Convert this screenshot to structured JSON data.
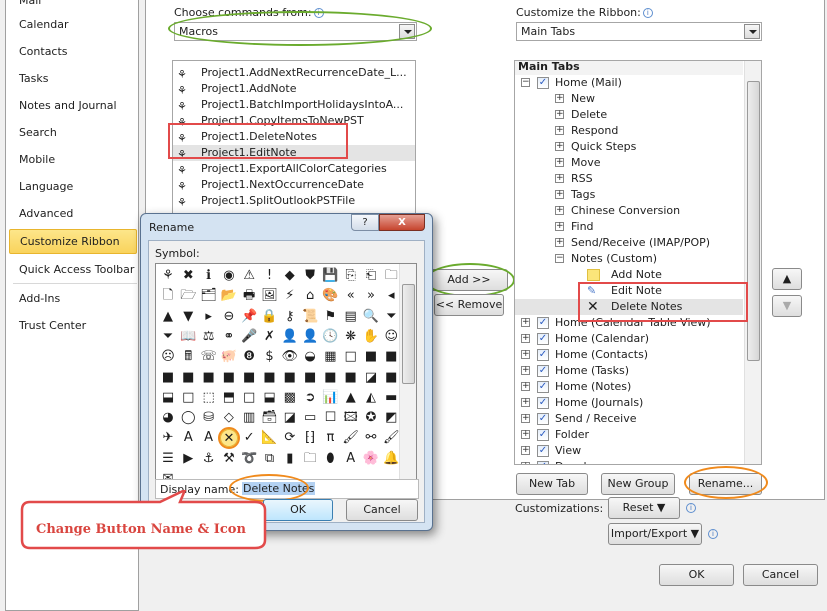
{
  "nav": {
    "items": [
      "Mail",
      "Calendar",
      "Contacts",
      "Tasks",
      "Notes and Journal",
      "Search",
      "Mobile",
      "Language",
      "Advanced",
      "Customize Ribbon",
      "Quick Access Toolbar",
      "Add-Ins",
      "Trust Center"
    ],
    "selected": "Customize Ribbon"
  },
  "commands": {
    "label": "Choose commands from:",
    "value": "Macros",
    "items": [
      "Project1.AddNextRecurrenceDate_L...",
      "Project1.AddNote",
      "Project1.BatchImportHolidaysIntoA...",
      "Project1.CopyItemsToNewPST",
      "Project1.DeleteNotes",
      "Project1.EditNote",
      "Project1.ExportAllColorCategories",
      "Project1.NextOccurrenceDate",
      "Project1.SplitOutlookPSTFile"
    ],
    "selected": "Project1.EditNote"
  },
  "middle": {
    "add": "Add >>",
    "remove": "<< Remove"
  },
  "ribbon": {
    "label": "Customize the Ribbon:",
    "value": "Main Tabs",
    "header": "Main Tabs",
    "home_mail": "Home (Mail)",
    "groups": [
      "New",
      "Delete",
      "Respond",
      "Quick Steps",
      "Move",
      "RSS",
      "Tags",
      "Chinese Conversion",
      "Find",
      "Send/Receive (IMAP/POP)"
    ],
    "custom_group": "Notes (Custom)",
    "custom_items": [
      "Add Note",
      "Edit Note",
      "Delete Notes"
    ],
    "tabs": [
      "Home (Calendar Table View)",
      "Home (Calendar)",
      "Home (Contacts)",
      "Home (Tasks)",
      "Home (Notes)",
      "Home (Journals)",
      "Send / Receive",
      "Folder",
      "View",
      "Developer"
    ]
  },
  "ribbon_buttons": {
    "new_tab": "New Tab",
    "new_group": "New Group",
    "rename": "Rename..."
  },
  "customizations": {
    "label": "Customizations:",
    "reset": "Reset ▼",
    "import_export": "Import/Export ▼"
  },
  "footer": {
    "ok": "OK",
    "cancel": "Cancel"
  },
  "rename_dialog": {
    "title": "Rename",
    "help": "?",
    "close": "X",
    "symbol_label": "Symbol:",
    "display_name_label": "Display name:",
    "display_name_value": "Delete Notes",
    "ok": "OK",
    "cancel": "Cancel",
    "symbols": [
      "⚘",
      "✖",
      "ℹ",
      "◉",
      "⚠",
      "!",
      "◆",
      "⛊",
      "💾",
      "⎘",
      "⎗",
      "🗀",
      "🗋",
      "🗁",
      "🗂",
      "📂",
      "🖶",
      "🖼",
      "⚡",
      "⌂",
      "🎨",
      "«",
      "»",
      "◂",
      "▲",
      "▼",
      "▸",
      "⊖",
      "📌",
      "🔒",
      "⚷",
      "📜",
      "⚑",
      "▤",
      "🔍",
      "⏷",
      "⏷",
      "📖",
      "⚖",
      "⚭",
      "🎤",
      "✗",
      "👤",
      "👤",
      "🕓",
      "❋",
      "✋",
      "☺",
      "☹",
      "🖩",
      "☏",
      "🐖",
      "❽",
      "$",
      "👁",
      "◒",
      "▦",
      "□",
      "■",
      "■",
      "■",
      "■",
      "■",
      "■",
      "■",
      "■",
      "■",
      "■",
      "■",
      "■",
      "◪",
      "■",
      "⬓",
      "□",
      "⬚",
      "⬒",
      "□",
      "⬓",
      "▩",
      "➲",
      "📊",
      "▲",
      "◭",
      "▬",
      "◕",
      "◯",
      "⛁",
      "◇",
      "▥",
      "🗃",
      "◪",
      "▭",
      "☐",
      "🖾",
      "✪",
      "◩",
      "✈",
      "A",
      "A",
      "✕",
      "✓",
      "📐",
      "⟳",
      "⁅⁆",
      "π",
      "🖌",
      "⚯",
      "🖌",
      "☰",
      "▶",
      "⚓",
      "⚒",
      "➰",
      "⧉",
      "▮",
      "🗀",
      "⬮",
      "A",
      "🌸",
      "🔔",
      "✉"
    ],
    "selected_symbol": "✕"
  },
  "callout": "Change Button Name & Icon",
  "colors": {
    "accent_green": "#6aab2d",
    "accent_orange": "#f08a1c",
    "accent_red": "#e24a4a",
    "selection": "#fde68a"
  }
}
